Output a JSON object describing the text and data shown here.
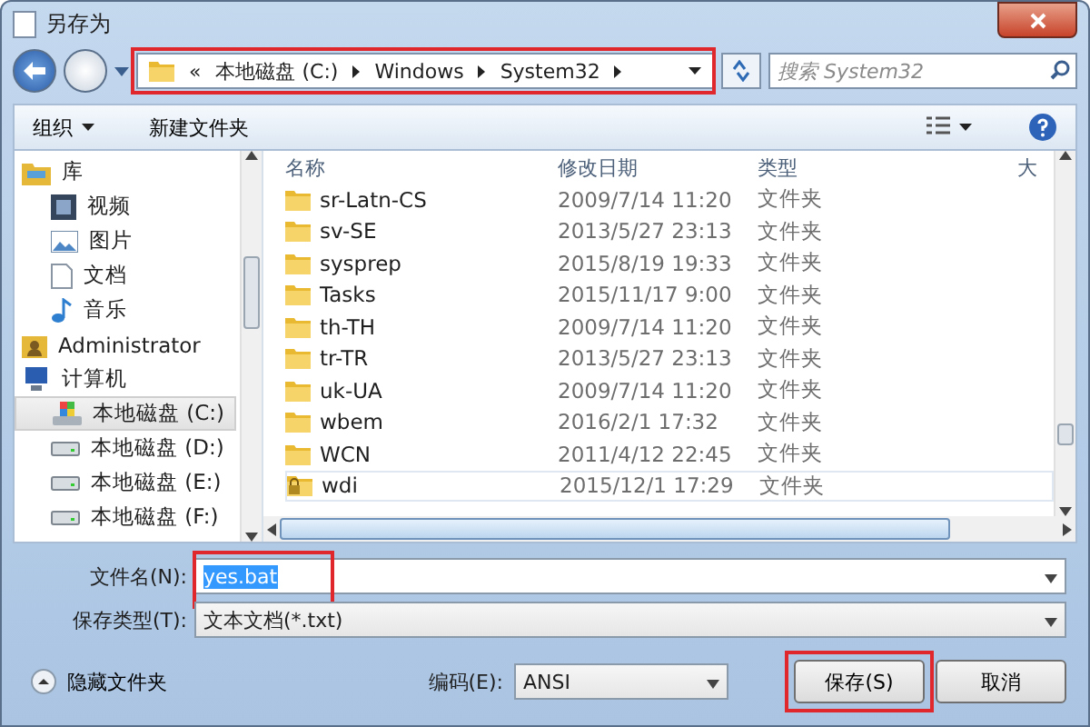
{
  "window": {
    "title": "另存为"
  },
  "address": {
    "overflow": "«",
    "crumbs": [
      "本地磁盘 (C:)",
      "Windows",
      "System32"
    ],
    "highlighted": true
  },
  "search": {
    "placeholder": "搜索 System32"
  },
  "toolbar": {
    "organize": "组织",
    "new_folder": "新建文件夹"
  },
  "sidebar": {
    "items": [
      {
        "label": "库",
        "kind": "library",
        "selected": false,
        "children": [
          {
            "label": "视频",
            "kind": "video",
            "selected": false
          },
          {
            "label": "图片",
            "kind": "picture",
            "selected": false
          },
          {
            "label": "文档",
            "kind": "document",
            "selected": false
          },
          {
            "label": "音乐",
            "kind": "music",
            "selected": false
          }
        ]
      },
      {
        "label": "Administrator",
        "kind": "user",
        "selected": false
      },
      {
        "label": "计算机",
        "kind": "computer",
        "selected": false,
        "children": [
          {
            "label": "本地磁盘 (C:)",
            "kind": "system-drive",
            "selected": true
          },
          {
            "label": "本地磁盘 (D:)",
            "kind": "drive",
            "selected": false
          },
          {
            "label": "本地磁盘 (E:)",
            "kind": "drive",
            "selected": false
          },
          {
            "label": "本地磁盘 (F:)",
            "kind": "drive",
            "selected": false
          }
        ]
      }
    ]
  },
  "table": {
    "columns": [
      "名称",
      "修改日期",
      "类型",
      "大"
    ],
    "rows": [
      {
        "name": "sr-Latn-CS",
        "date": "2009/7/14 11:20",
        "type": "文件夹",
        "locked": false,
        "selected": false
      },
      {
        "name": "sv-SE",
        "date": "2013/5/27 23:13",
        "type": "文件夹",
        "locked": false,
        "selected": false
      },
      {
        "name": "sysprep",
        "date": "2015/8/19 19:33",
        "type": "文件夹",
        "locked": false,
        "selected": false
      },
      {
        "name": "Tasks",
        "date": "2015/11/17 9:00",
        "type": "文件夹",
        "locked": false,
        "selected": false
      },
      {
        "name": "th-TH",
        "date": "2009/7/14 11:20",
        "type": "文件夹",
        "locked": false,
        "selected": false
      },
      {
        "name": "tr-TR",
        "date": "2013/5/27 23:13",
        "type": "文件夹",
        "locked": false,
        "selected": false
      },
      {
        "name": "uk-UA",
        "date": "2009/7/14 11:20",
        "type": "文件夹",
        "locked": false,
        "selected": false
      },
      {
        "name": "wbem",
        "date": "2016/2/1 17:32",
        "type": "文件夹",
        "locked": false,
        "selected": false
      },
      {
        "name": "WCN",
        "date": "2011/4/12 22:45",
        "type": "文件夹",
        "locked": false,
        "selected": false
      },
      {
        "name": "wdi",
        "date": "2015/12/1 17:29",
        "type": "文件夹",
        "locked": true,
        "selected": true
      }
    ]
  },
  "filename": {
    "label": "文件名(N):",
    "value": "yes.bat",
    "text_selected": true,
    "highlighted": true
  },
  "filetype": {
    "label": "保存类型(T):",
    "value": "文本文档(*.txt)"
  },
  "hide_folders": "隐藏文件夹",
  "encoding": {
    "label": "编码(E):",
    "value": "ANSI"
  },
  "buttons": [
    {
      "label": "保存(S)",
      "highlighted": true
    },
    {
      "label": "取消",
      "highlighted": false
    }
  ]
}
